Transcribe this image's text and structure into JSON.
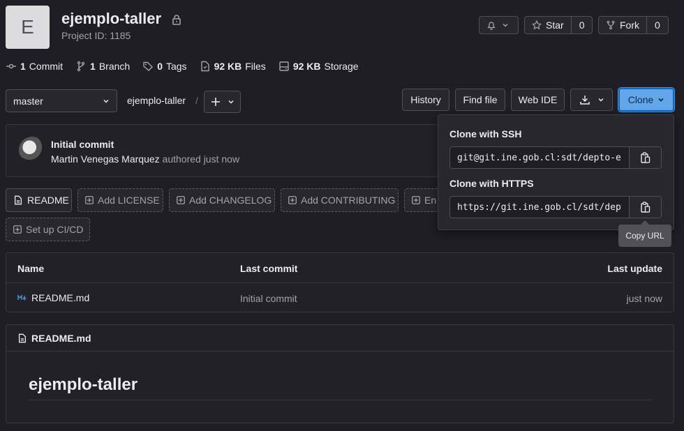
{
  "project": {
    "avatar_letter": "E",
    "name": "ejemplo-taller",
    "id_label": "Project ID: 1185"
  },
  "actions": {
    "star_label": "Star",
    "star_count": "0",
    "fork_label": "Fork",
    "fork_count": "0"
  },
  "stats": [
    {
      "value": "1",
      "label": "Commit",
      "icon": "commit-icon"
    },
    {
      "value": "1",
      "label": "Branch",
      "icon": "branch-icon"
    },
    {
      "value": "0",
      "label": "Tags",
      "icon": "tag-icon"
    },
    {
      "value": "92 KB",
      "label": "Files",
      "icon": "file-icon"
    },
    {
      "value": "92 KB",
      "label": "Storage",
      "icon": "storage-icon"
    }
  ],
  "toolbar": {
    "branch": "master",
    "breadcrumb": "ejemplo-taller",
    "separator": "/",
    "history": "History",
    "find_file": "Find file",
    "web_ide": "Web IDE",
    "clone": "Clone"
  },
  "commit": {
    "title": "Initial commit",
    "author": "Martin Venegas Marquez",
    "meta": "authored just now"
  },
  "quick_links": {
    "readme": "README",
    "add_license": "Add LICENSE",
    "add_changelog": "Add CHANGELOG",
    "add_contributing": "Add CONTRIBUTING",
    "enable_truncated": "En",
    "setup_ci": "Set up CI/CD"
  },
  "table": {
    "headers": {
      "name": "Name",
      "last_commit": "Last commit",
      "last_update": "Last update"
    },
    "rows": [
      {
        "name": "README.md",
        "last_commit": "Initial commit",
        "last_update": "just now"
      }
    ]
  },
  "readme": {
    "filename": "README.md",
    "heading": "ejemplo-taller"
  },
  "clone_dropdown": {
    "ssh_label": "Clone with SSH",
    "ssh_url": "git@git.ine.gob.cl:sdt/depto-es",
    "https_label": "Clone with HTTPS",
    "https_url": "https://git.ine.gob.cl/sdt/dept",
    "tooltip": "Copy URL"
  },
  "colors": {
    "background": "#1f1e24",
    "clone_button": "#63a6e9",
    "accent": "#1068bf"
  }
}
